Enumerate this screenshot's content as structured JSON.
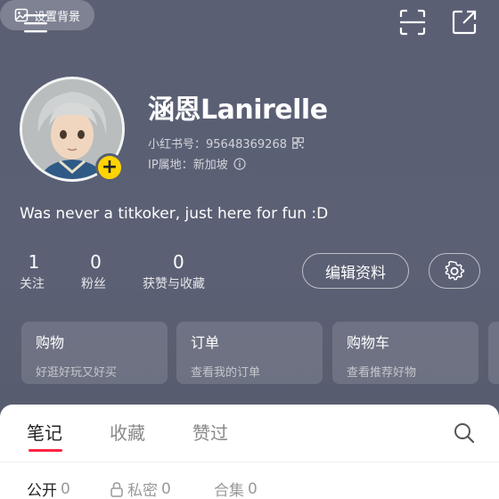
{
  "topbar": {
    "background_button_label": "设置背景"
  },
  "profile": {
    "nickname": "涵恩Lanirelle",
    "id_label": "小红书号：",
    "id_value": "95648369268",
    "ip_label": "IP属地：",
    "ip_value": "新加坡",
    "bio": "Was never a titkoker, just here for fun :D"
  },
  "stats": [
    {
      "value": "1",
      "label": "关注"
    },
    {
      "value": "0",
      "label": "粉丝"
    },
    {
      "value": "0",
      "label": "获赞与收藏"
    }
  ],
  "actions": {
    "edit_label": "编辑资料"
  },
  "cards": [
    {
      "title": "购物",
      "subtitle": "好逛好玩又好买"
    },
    {
      "title": "订单",
      "subtitle": "查看我的订单"
    },
    {
      "title": "购物车",
      "subtitle": "查看推荐好物"
    }
  ],
  "tabs": [
    {
      "label": "笔记",
      "active": true
    },
    {
      "label": "收藏",
      "active": false
    },
    {
      "label": "赞过",
      "active": false
    }
  ],
  "subtabs": [
    {
      "label": "公开",
      "count": "0"
    },
    {
      "label": "私密",
      "count": "0"
    },
    {
      "label": "合集",
      "count": "0"
    }
  ],
  "colors": {
    "accent": "#ff2442",
    "badge": "#ffd400",
    "header_bg": "#5a5f74"
  },
  "icons": {
    "menu": "menu-icon",
    "background": "image-icon",
    "scan": "scan-icon",
    "share": "share-icon",
    "qrcode": "qrcode-icon",
    "info": "info-icon",
    "settings": "gear-icon",
    "search": "search-icon",
    "lock": "lock-icon"
  }
}
